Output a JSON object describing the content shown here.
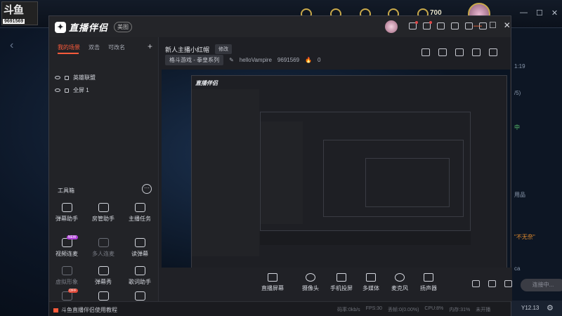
{
  "background": {
    "logo_text": "斗鱼",
    "room_id": "9691569",
    "coin_count": "700",
    "window_controls": [
      "—",
      "☐",
      "✕"
    ],
    "right_panel": {
      "items": [
        "1:19",
        "/5)",
        "中",
        "用品",
        "\"不无奈\"",
        "ca"
      ],
      "bottom_label": "Y12.13"
    }
  },
  "app": {
    "name": "直播伴侣",
    "version_badge": "美图",
    "window_controls": {
      "minimize": "—",
      "maximize": "☐",
      "close": "✕"
    }
  },
  "left_panel": {
    "tabs": [
      {
        "label": "我的场景",
        "active": true
      },
      {
        "label": "双击"
      },
      {
        "label": "可改名"
      }
    ],
    "add_label": "+",
    "scenes": [
      {
        "label": "英雄联盟"
      },
      {
        "label": "全屏 1"
      }
    ],
    "tools_title": "工具箱",
    "tools_more": "⋯",
    "tools": [
      {
        "label": "弹幕助手",
        "icon": "chat-icon",
        "dim": false
      },
      {
        "label": "房管助手",
        "icon": "user-icon",
        "dim": false
      },
      {
        "label": "主播任务",
        "icon": "checklist-icon",
        "dim": false
      },
      {
        "label": "视频连麦",
        "icon": "video-call-icon",
        "dim": false,
        "badge": "NEW"
      },
      {
        "label": "多人连麦",
        "icon": "download-icon",
        "dim": true
      },
      {
        "label": "读弹幕",
        "icon": "read-icon",
        "dim": false
      },
      {
        "label": "虚拟形象",
        "icon": "avatar-icon",
        "dim": true
      },
      {
        "label": "弹幕秀",
        "icon": "download-icon",
        "dim": false
      },
      {
        "label": "歌词助手",
        "icon": "music-icon",
        "dim": false
      },
      {
        "label": "",
        "icon": "gift-icon",
        "dim": true,
        "badge": "OFF"
      },
      {
        "label": "",
        "icon": "download-icon",
        "dim": false
      },
      {
        "label": "",
        "icon": "game-icon",
        "dim": false
      }
    ]
  },
  "stream_info": {
    "title": "新人主播小红帽",
    "edit_label": "修改",
    "category": "格斗游戏 - 拳皇系列",
    "streamer": "helloVampire",
    "room_id": "9691569",
    "heat": "0"
  },
  "bottom_toolbar": {
    "buttons": [
      {
        "label": "直播屏幕",
        "icon": "screen-icon"
      },
      {
        "label": "摄像头",
        "icon": "camera-icon"
      },
      {
        "label": "手机投屏",
        "icon": "phone-icon"
      },
      {
        "label": "多媒体",
        "icon": "media-icon"
      },
      {
        "label": "麦克风",
        "icon": "mic-icon"
      },
      {
        "label": "扬声器",
        "icon": "speaker-icon"
      }
    ],
    "live_button": "连接中..."
  },
  "status_bar": {
    "tutorial": "斗鱼直播伴侣使用教程",
    "stats": [
      "码率:0kb/s",
      "FPS:30",
      "丢帧:0(0.00%)",
      "CPU:8%",
      "内存:31%",
      "未开播"
    ]
  }
}
